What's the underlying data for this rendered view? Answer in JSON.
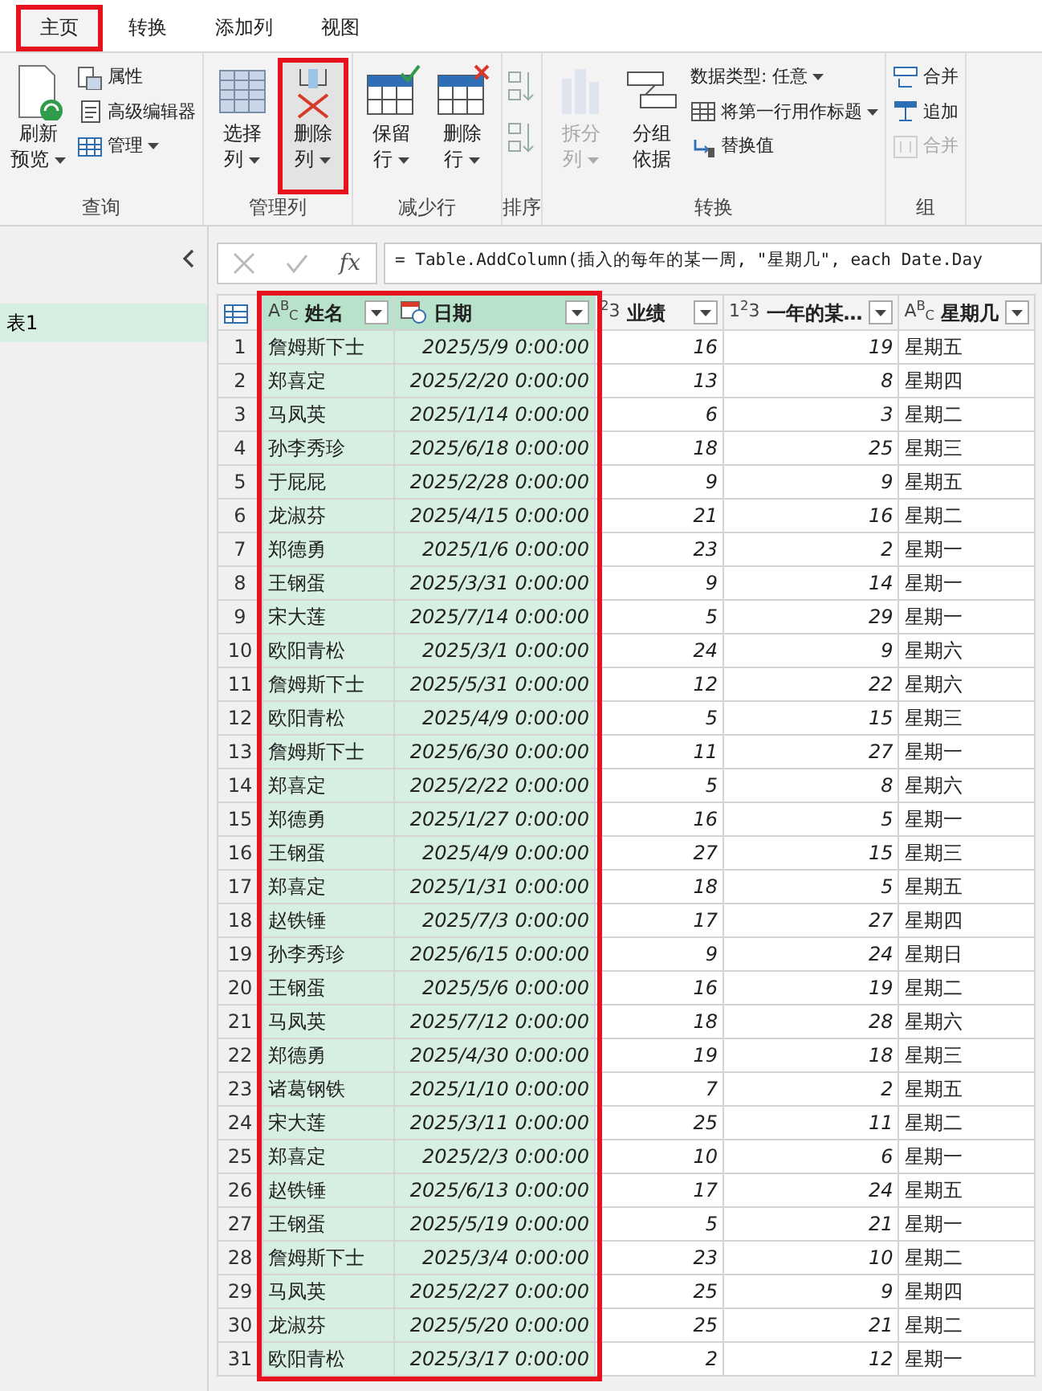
{
  "tabs": [
    {
      "label": "主页",
      "selected": true,
      "highlighted": true
    },
    {
      "label": "转换",
      "selected": false,
      "highlighted": false
    },
    {
      "label": "添加列",
      "selected": false,
      "highlighted": false
    },
    {
      "label": "视图",
      "selected": false,
      "highlighted": false
    }
  ],
  "ribbon": [
    {
      "label": "查询",
      "buttons": [
        {
          "kind": "large",
          "lines": [
            "刷新",
            "预览"
          ],
          "dropdown": true,
          "disabled": false,
          "highlighted": false
        },
        {
          "kind": "stack",
          "items": [
            {
              "label": "属性",
              "dropdown": false,
              "disabled": false
            },
            {
              "label": "高级编辑器",
              "dropdown": false,
              "disabled": false
            },
            {
              "label": "管理",
              "dropdown": true,
              "disabled": false
            }
          ]
        }
      ]
    },
    {
      "label": "管理列",
      "buttons": [
        {
          "kind": "large",
          "lines": [
            "选择",
            "列"
          ],
          "dropdown": true,
          "disabled": false,
          "highlighted": false
        },
        {
          "kind": "large",
          "lines": [
            "删除",
            "列"
          ],
          "dropdown": true,
          "disabled": false,
          "highlighted": true
        }
      ]
    },
    {
      "label": "减少行",
      "buttons": [
        {
          "kind": "large",
          "lines": [
            "保留",
            "行"
          ],
          "dropdown": true,
          "disabled": false,
          "highlighted": false
        },
        {
          "kind": "large",
          "lines": [
            "删除",
            "行"
          ],
          "dropdown": true,
          "disabled": false,
          "highlighted": false
        }
      ]
    },
    {
      "label": "排序",
      "buttons": [
        {
          "kind": "sort",
          "disabled": true
        }
      ]
    },
    {
      "label": "转换",
      "buttons": [
        {
          "kind": "large",
          "lines": [
            "拆分",
            "列"
          ],
          "dropdown": true,
          "disabled": true,
          "highlighted": false
        },
        {
          "kind": "large",
          "lines": [
            "分组",
            "依据"
          ],
          "dropdown": false,
          "disabled": false,
          "highlighted": false
        },
        {
          "kind": "stack",
          "items": [
            {
              "label": "数据类型: 任意",
              "dropdown": true,
              "disabled": false
            },
            {
              "label": "将第一行用作标题",
              "dropdown": true,
              "disabled": false
            },
            {
              "label": "替换值",
              "dropdown": false,
              "disabled": false
            }
          ]
        }
      ]
    },
    {
      "label": "组",
      "buttons": [
        {
          "kind": "stack",
          "items": [
            {
              "label": "合并",
              "dropdown": false,
              "disabled": false
            },
            {
              "label": "追加",
              "dropdown": false,
              "disabled": false
            },
            {
              "label": "合并",
              "dropdown": false,
              "disabled": true
            }
          ]
        }
      ]
    }
  ],
  "queries": [
    {
      "label": "表1",
      "selected": true
    }
  ],
  "formula_bar": {
    "fx_label": "fx",
    "formula": "= Table.AddColumn(插入的每年的某一周, \"星期几\", each Date.Day"
  },
  "table": {
    "columns": [
      {
        "title": "姓名",
        "type_label": "A$^{B}$$_{C}$",
        "kind": "text",
        "selected": true,
        "highlighted": true
      },
      {
        "title": "日期",
        "kind": "datetime",
        "selected": true,
        "highlighted": true
      },
      {
        "title": "业绩",
        "type_label": "$^{2}$3",
        "kind": "number",
        "selected": false,
        "highlighted": false
      },
      {
        "title": "一年的某…",
        "type_label": "1$^{2}$3",
        "kind": "number",
        "selected": false,
        "highlighted": false
      },
      {
        "title": "星期几",
        "type_label": "A$^{B}$$_{C}$",
        "kind": "text",
        "selected": false,
        "highlighted": false
      }
    ],
    "rows": [
      {
        "n": "1",
        "cells": [
          "詹姆斯下士",
          "2025/5/9 0:00:00",
          "16",
          "19",
          "星期五"
        ]
      },
      {
        "n": "2",
        "cells": [
          "郑喜定",
          "2025/2/20 0:00:00",
          "13",
          "8",
          "星期四"
        ]
      },
      {
        "n": "3",
        "cells": [
          "马凤英",
          "2025/1/14 0:00:00",
          "6",
          "3",
          "星期二"
        ]
      },
      {
        "n": "4",
        "cells": [
          "孙李秀珍",
          "2025/6/18 0:00:00",
          "18",
          "25",
          "星期三"
        ]
      },
      {
        "n": "5",
        "cells": [
          "于屁屁",
          "2025/2/28 0:00:00",
          "9",
          "9",
          "星期五"
        ]
      },
      {
        "n": "6",
        "cells": [
          "龙淑芬",
          "2025/4/15 0:00:00",
          "21",
          "16",
          "星期二"
        ]
      },
      {
        "n": "7",
        "cells": [
          "郑德勇",
          "2025/1/6 0:00:00",
          "23",
          "2",
          "星期一"
        ]
      },
      {
        "n": "8",
        "cells": [
          "王钢蛋",
          "2025/3/31 0:00:00",
          "9",
          "14",
          "星期一"
        ]
      },
      {
        "n": "9",
        "cells": [
          "宋大莲",
          "2025/7/14 0:00:00",
          "5",
          "29",
          "星期一"
        ]
      },
      {
        "n": "10",
        "cells": [
          "欧阳青松",
          "2025/3/1 0:00:00",
          "24",
          "9",
          "星期六"
        ]
      },
      {
        "n": "11",
        "cells": [
          "詹姆斯下士",
          "2025/5/31 0:00:00",
          "12",
          "22",
          "星期六"
        ]
      },
      {
        "n": "12",
        "cells": [
          "欧阳青松",
          "2025/4/9 0:00:00",
          "5",
          "15",
          "星期三"
        ]
      },
      {
        "n": "13",
        "cells": [
          "詹姆斯下士",
          "2025/6/30 0:00:00",
          "11",
          "27",
          "星期一"
        ]
      },
      {
        "n": "14",
        "cells": [
          "郑喜定",
          "2025/2/22 0:00:00",
          "5",
          "8",
          "星期六"
        ]
      },
      {
        "n": "15",
        "cells": [
          "郑德勇",
          "2025/1/27 0:00:00",
          "16",
          "5",
          "星期一"
        ]
      },
      {
        "n": "16",
        "cells": [
          "王钢蛋",
          "2025/4/9 0:00:00",
          "27",
          "15",
          "星期三"
        ]
      },
      {
        "n": "17",
        "cells": [
          "郑喜定",
          "2025/1/31 0:00:00",
          "18",
          "5",
          "星期五"
        ]
      },
      {
        "n": "18",
        "cells": [
          "赵铁锤",
          "2025/7/3 0:00:00",
          "17",
          "27",
          "星期四"
        ]
      },
      {
        "n": "19",
        "cells": [
          "孙李秀珍",
          "2025/6/15 0:00:00",
          "9",
          "24",
          "星期日"
        ]
      },
      {
        "n": "20",
        "cells": [
          "王钢蛋",
          "2025/5/6 0:00:00",
          "16",
          "19",
          "星期二"
        ]
      },
      {
        "n": "21",
        "cells": [
          "马凤英",
          "2025/7/12 0:00:00",
          "18",
          "28",
          "星期六"
        ]
      },
      {
        "n": "22",
        "cells": [
          "郑德勇",
          "2025/4/30 0:00:00",
          "19",
          "18",
          "星期三"
        ]
      },
      {
        "n": "23",
        "cells": [
          "诸葛钢铁",
          "2025/1/10 0:00:00",
          "7",
          "2",
          "星期五"
        ]
      },
      {
        "n": "24",
        "cells": [
          "宋大莲",
          "2025/3/11 0:00:00",
          "25",
          "11",
          "星期二"
        ]
      },
      {
        "n": "25",
        "cells": [
          "郑喜定",
          "2025/2/3 0:00:00",
          "10",
          "6",
          "星期一"
        ]
      },
      {
        "n": "26",
        "cells": [
          "赵铁锤",
          "2025/6/13 0:00:00",
          "17",
          "24",
          "星期五"
        ]
      },
      {
        "n": "27",
        "cells": [
          "王钢蛋",
          "2025/5/19 0:00:00",
          "5",
          "21",
          "星期一"
        ]
      },
      {
        "n": "28",
        "cells": [
          "詹姆斯下士",
          "2025/3/4 0:00:00",
          "23",
          "10",
          "星期二"
        ]
      },
      {
        "n": "29",
        "cells": [
          "马凤英",
          "2025/2/27 0:00:00",
          "25",
          "9",
          "星期四"
        ]
      },
      {
        "n": "30",
        "cells": [
          "龙淑芬",
          "2025/5/20 0:00:00",
          "25",
          "21",
          "星期二"
        ]
      },
      {
        "n": "31",
        "cells": [
          "欧阳青松",
          "2025/3/17 0:00:00",
          "2",
          "12",
          "星期一"
        ]
      }
    ]
  }
}
